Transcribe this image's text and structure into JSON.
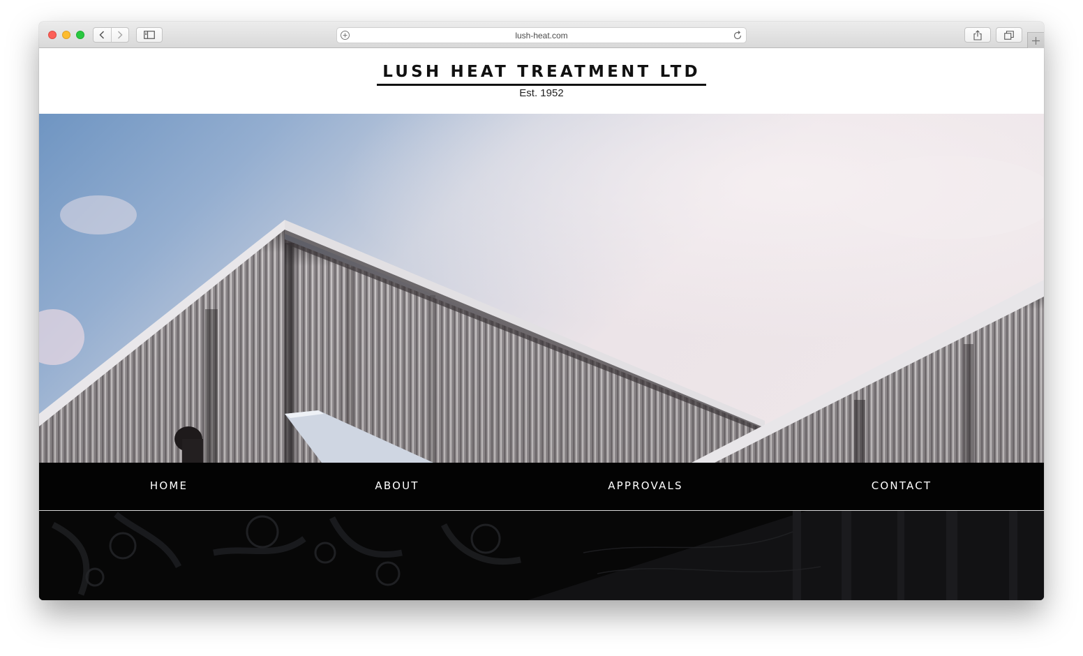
{
  "browser": {
    "url": "lush-heat.com",
    "icons": {
      "back": "chevron-left-icon",
      "forward": "chevron-right-icon",
      "sidebar": "sidebar-icon",
      "share": "share-icon",
      "tabs": "tabs-icon",
      "new_tab": "plus-icon",
      "reload": "reload-icon",
      "site_info": "add-icon"
    }
  },
  "site": {
    "title": "LUSH HEAT TREATMENT LTD",
    "tagline": "Est. 1952"
  },
  "nav": {
    "items": [
      {
        "label": "HOME"
      },
      {
        "label": "ABOUT"
      },
      {
        "label": "APPROVALS"
      },
      {
        "label": "CONTACT"
      }
    ]
  },
  "colors": {
    "nav_background": "#030303",
    "nav_text": "#ffffff",
    "title_text": "#111111",
    "sky_top": "#6f95c2",
    "sky_cloud": "#ece4e8"
  }
}
